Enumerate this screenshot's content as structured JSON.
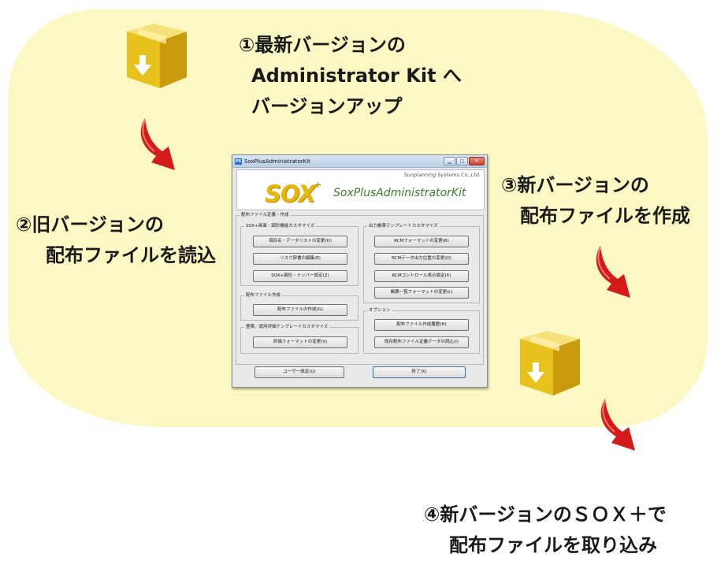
{
  "steps": {
    "step1": {
      "line1": "①最新バージョンの",
      "line2": "Administrator Kit へ",
      "line3": "バージョンアップ"
    },
    "step2": {
      "line1": "②旧バージョンの",
      "line2": "配布ファイルを読込"
    },
    "step3": {
      "line1": "③新バージョンの",
      "line2": "配布ファイルを作成"
    },
    "step4": {
      "line1": "④新バージョンのＳＯＸ＋で",
      "line2": "配布ファイルを取り込み"
    }
  },
  "icons": {
    "package": "package-download-icon",
    "arrow": "red-curved-arrow-icon"
  },
  "colors": {
    "background_blob": "#fbf8c4",
    "arrow_red": "#d41a1a",
    "box_yellow": "#e8c21c",
    "app_green": "#3c7d2e",
    "sox_yellow": "#e8b50a"
  },
  "window": {
    "title": "SoxPlusAdministratorKit",
    "title_icon": "PS",
    "company": "Sunplanning Systems.Co.,Ltd.",
    "logo_text": "SOX",
    "logo_plus": "+",
    "app_name": "SoxPlusAdministratorKit",
    "controls": {
      "minimize": "▁",
      "maximize": "□",
      "close": "✕"
    },
    "outer_group": "配布ファイル定義・作成",
    "groups": {
      "sox_custom": {
        "label": "SOX+画面・図形機能カスタマイズ",
        "buttons": [
          "項目名・データリストの変更(D)",
          "リスク辞書の編集(E)",
          "SOX+図形・ナンバー設定(Z)"
        ]
      },
      "dist_file": {
        "label": "配布ファイル作成",
        "buttons": [
          "配布ファイルの作成(G)"
        ]
      },
      "maintenance": {
        "label": "整備／運用評価テンプレートカスタマイズ",
        "buttons": [
          "評価フォーマットの変更(V)"
        ]
      },
      "report_template": {
        "label": "出力帳票テンプレートカスタマイズ",
        "buttons": [
          "RCMフォーマットの変更(R)",
          "RCMデータ出力位置の変更(O)",
          "RCMコントロール表示設定(K)",
          "帳票一覧フォーマットの変更(L)"
        ]
      },
      "options": {
        "label": "オプション",
        "buttons": [
          "配布ファイル作成履歴(H)",
          "既存配布ファイル定義データの読込(I)"
        ]
      }
    },
    "footer": {
      "user_settings": "ユーザー設定(U)",
      "exit": "終了(X)"
    }
  }
}
